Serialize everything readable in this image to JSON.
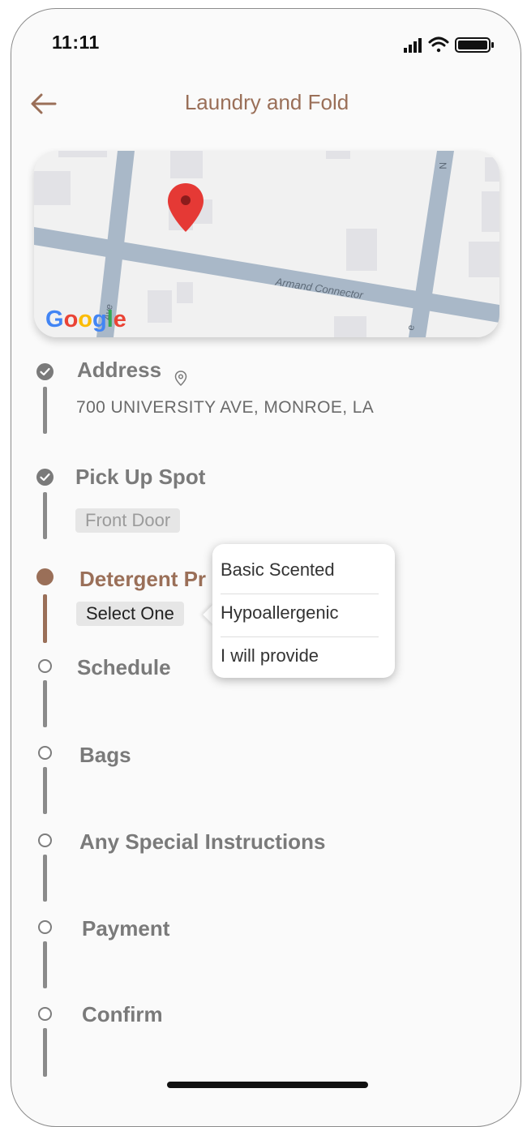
{
  "status_bar": {
    "time": "11:11"
  },
  "header": {
    "title": "Laundry and Fold"
  },
  "map": {
    "street_main": "Armand Connector",
    "street_side": "Ave",
    "street_top": "N",
    "street_right": "e",
    "brand": [
      "G",
      "o",
      "o",
      "g",
      "l",
      "e"
    ],
    "brand_colors": [
      "#4285F4",
      "#EA4335",
      "#FBBC05",
      "#4285F4",
      "#34A853",
      "#EA4335"
    ],
    "pin_color": "#E53935"
  },
  "steps": {
    "address": {
      "label": "Address",
      "value": "700 UNIVERSITY AVE, MONROE, LA"
    },
    "pickup": {
      "label": "Pick Up Spot",
      "value": "Front Door"
    },
    "detergent": {
      "label": "Detergent Pr",
      "value": "Select One"
    },
    "schedule": {
      "label": "Schedule"
    },
    "bags": {
      "label": "Bags"
    },
    "instructions": {
      "label": "Any Special Instructions"
    },
    "payment": {
      "label": "Payment"
    },
    "confirm": {
      "label": "Confirm"
    }
  },
  "detergent_menu": {
    "options": [
      "Basic Scented",
      "Hypoallergenic",
      "I will provide"
    ]
  },
  "colors": {
    "accent": "#9a6f58",
    "muted": "#7a7a7a"
  }
}
